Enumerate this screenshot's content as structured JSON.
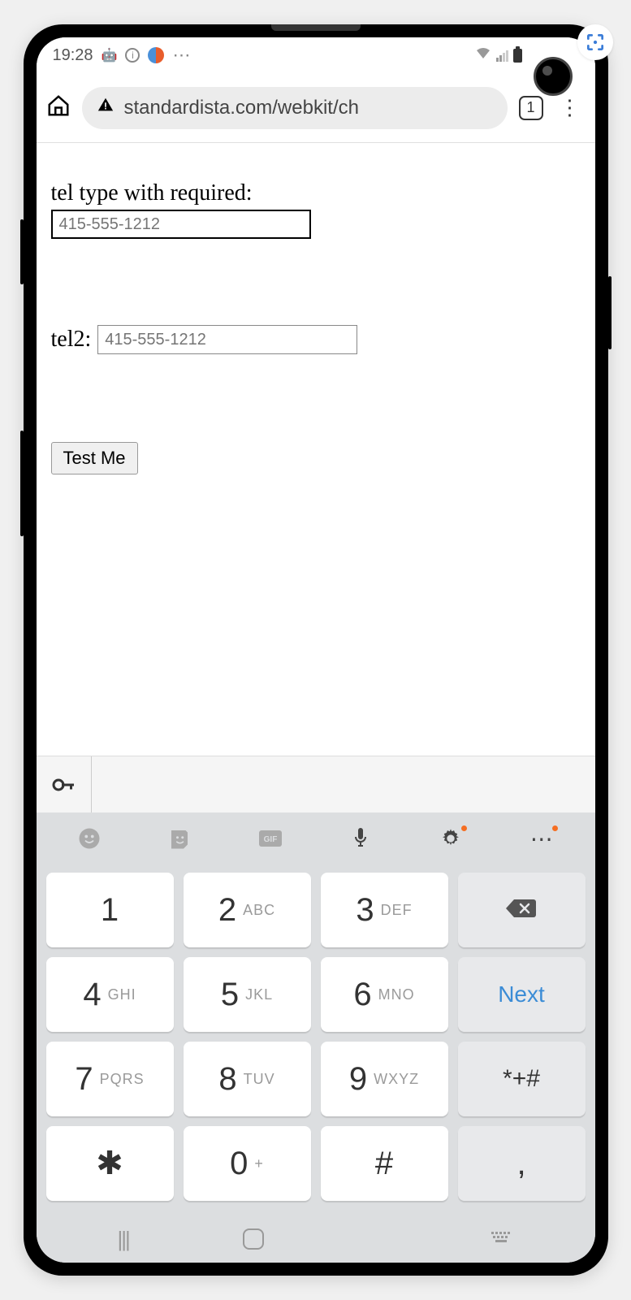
{
  "status": {
    "time": "19:28"
  },
  "browser": {
    "url": "standardista.com/webkit/ch",
    "tabs_count": "1"
  },
  "page": {
    "label1": "tel type with required:",
    "input1_placeholder": "415-555-1212",
    "label2": "tel2:",
    "input2_placeholder": "415-555-1212",
    "test_button": "Test Me"
  },
  "keyboard": {
    "keys": [
      {
        "num": "1",
        "sub": "",
        "cls": ""
      },
      {
        "num": "2",
        "sub": "ABC",
        "cls": ""
      },
      {
        "num": "3",
        "sub": "DEF",
        "cls": ""
      },
      {
        "type": "backspace",
        "cls": "gray"
      },
      {
        "num": "4",
        "sub": "GHI",
        "cls": ""
      },
      {
        "num": "5",
        "sub": "JKL",
        "cls": ""
      },
      {
        "num": "6",
        "sub": "MNO",
        "cls": ""
      },
      {
        "type": "next",
        "label": "Next",
        "cls": "gray next"
      },
      {
        "num": "7",
        "sub": "PQRS",
        "cls": ""
      },
      {
        "num": "8",
        "sub": "TUV",
        "cls": ""
      },
      {
        "num": "9",
        "sub": "WXYZ",
        "cls": ""
      },
      {
        "num": "*+#",
        "sub": "",
        "cls": "gray sym"
      },
      {
        "num": "✱",
        "sub": "",
        "cls": ""
      },
      {
        "num": "0",
        "sub": "+",
        "cls": ""
      },
      {
        "num": "#",
        "sub": "",
        "cls": ""
      },
      {
        "num": ",",
        "sub": "",
        "cls": "gray"
      }
    ]
  }
}
